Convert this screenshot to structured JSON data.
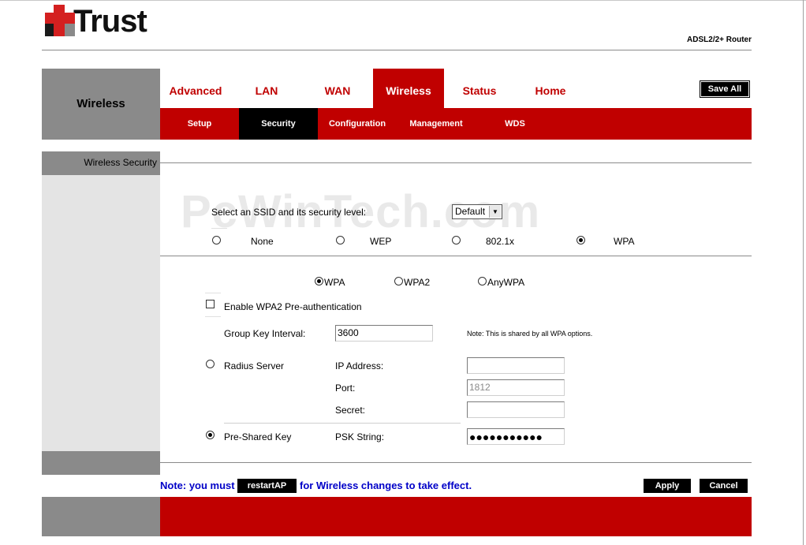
{
  "brand": {
    "logo_text": "Trust",
    "product": "ADSL2/2+ Router"
  },
  "section_title": "Wireless",
  "nav": {
    "tabs": [
      {
        "label": "Advanced",
        "active": false
      },
      {
        "label": "LAN",
        "active": false
      },
      {
        "label": "WAN",
        "active": false
      },
      {
        "label": "Wireless",
        "active": true
      },
      {
        "label": "Status",
        "active": false
      },
      {
        "label": "Home",
        "active": false
      }
    ],
    "save_all_label": "Save All",
    "subtabs": [
      {
        "label": "Setup",
        "active": false
      },
      {
        "label": "Security",
        "active": true
      },
      {
        "label": "Configuration",
        "active": false
      },
      {
        "label": "Management",
        "active": false
      },
      {
        "label": "WDS",
        "active": false
      }
    ]
  },
  "sidebar": {
    "heading": "Wireless Security"
  },
  "watermark": "PcWinTech.com",
  "security": {
    "ssid_label": "Select an SSID and its security level:",
    "ssid_value": "Default",
    "levels": [
      {
        "label": "None",
        "checked": false
      },
      {
        "label": "WEP",
        "checked": false
      },
      {
        "label": "802.1x",
        "checked": false
      },
      {
        "label": "WPA",
        "checked": true
      }
    ],
    "wpa_modes": [
      {
        "label": "WPA",
        "checked": true
      },
      {
        "label": "WPA2",
        "checked": false
      },
      {
        "label": "AnyWPA",
        "checked": false
      }
    ],
    "preauth_label": "Enable WPA2 Pre-authentication",
    "preauth_checked": false,
    "group_key_label": "Group Key Interval:",
    "group_key_value": "3600",
    "group_key_note": "Note: This is shared by all WPA options.",
    "radius_label": "Radius Server",
    "radius_checked": false,
    "ip_label": "IP Address:",
    "ip_value": "",
    "port_label": "Port:",
    "port_value": "1812",
    "secret_label": "Secret:",
    "secret_value": "",
    "psk_label": "Pre-Shared Key",
    "psk_checked": true,
    "psk_string_label": "PSK String:",
    "psk_value": "●●●●●●●●●●●"
  },
  "footer": {
    "note_prefix": "Note: you must",
    "restart_label": "restartAP",
    "note_suffix": "for Wireless changes to take effect.",
    "apply_label": "Apply",
    "cancel_label": "Cancel"
  }
}
